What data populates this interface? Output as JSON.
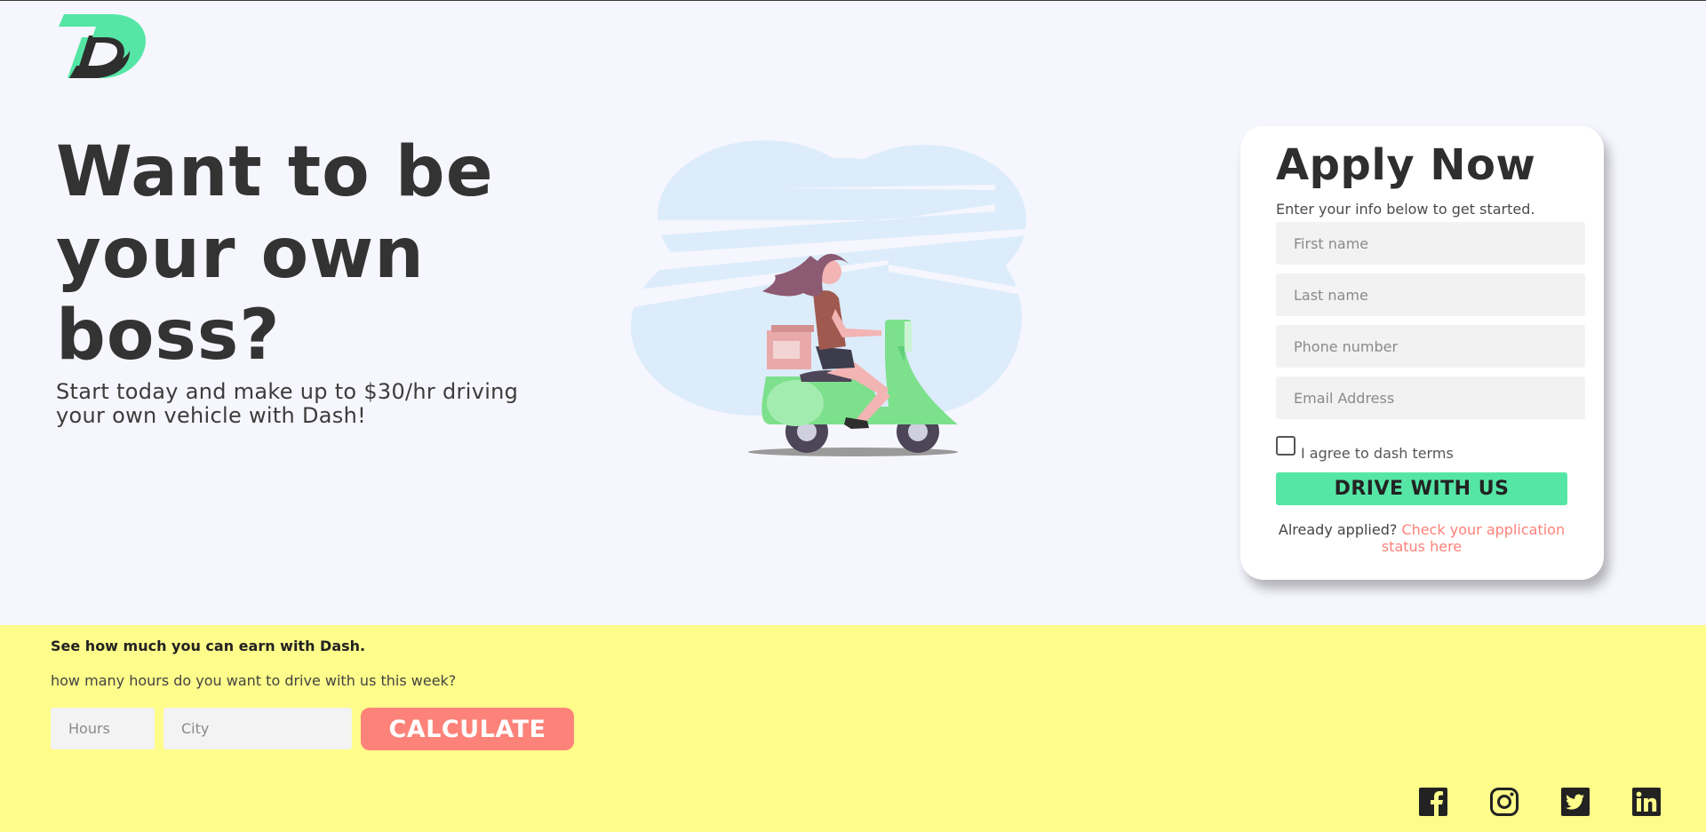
{
  "brand": {
    "logo_icon": "dash-d-logo-icon",
    "logo_color": "#55e6a5"
  },
  "hero": {
    "title": "Want to be your own boss?",
    "subtitle": "Start today and make up to $30/hr driving your own vehicle with Dash!",
    "illustration": "woman-on-scooter-illustration"
  },
  "apply": {
    "title": "Apply Now",
    "intro": "Enter your info below to get started.",
    "first_name_placeholder": "First name",
    "last_name_placeholder": "Last name",
    "phone_placeholder": "Phone number",
    "email_placeholder": "Email Address",
    "terms_label": "I agree to dash terms",
    "terms_checked": false,
    "submit_label": "DRIVE WITH US",
    "already_text": "Already applied?",
    "status_link": "Check your application status here"
  },
  "earnings": {
    "heading": "See how much you can earn with Dash.",
    "question": "how many hours do you want to drive with us this week?",
    "hours_placeholder": "Hours",
    "city_placeholder": "City",
    "calculate_label": "CALCULATE"
  },
  "social": [
    "facebook-icon",
    "instagram-icon",
    "twitter-icon",
    "linkedin-icon"
  ],
  "colors": {
    "background": "#f6f6fe",
    "accent_green": "#55e6a5",
    "accent_coral": "#fd8279",
    "band_yellow": "#fefc8a",
    "text_dark": "#2f2f2f"
  }
}
